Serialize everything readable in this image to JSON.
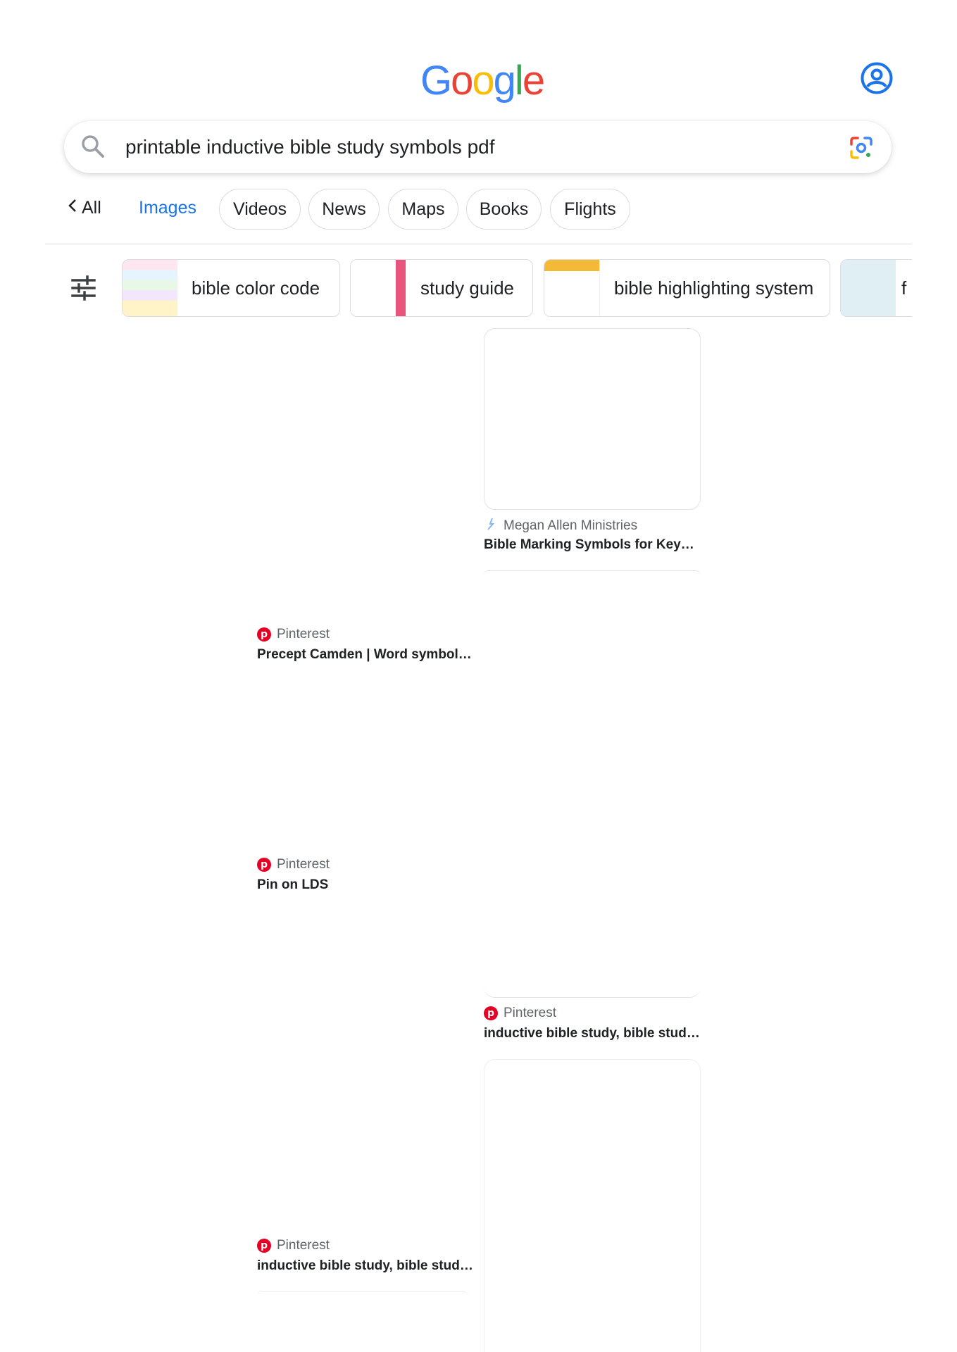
{
  "logo": {
    "letters": [
      "G",
      "o",
      "o",
      "g",
      "l",
      "e"
    ],
    "colors": [
      "#4285F4",
      "#EA4335",
      "#FBBC05",
      "#4285F4",
      "#34A853",
      "#EA4335"
    ]
  },
  "search": {
    "query": "printable inductive bible study symbols pdf"
  },
  "tabs": {
    "back_label": "All",
    "active": "Images",
    "chips": [
      "Videos",
      "News",
      "Maps",
      "Books",
      "Flights"
    ]
  },
  "refinements": [
    {
      "label": "bible color code"
    },
    {
      "label": "study guide"
    },
    {
      "label": "bible highlighting system"
    },
    {
      "label": "f"
    }
  ],
  "results": [
    {
      "source": "Megan Allen Ministries",
      "title": "Bible Marking Symbols for Key…",
      "icon": "sparkle-icon"
    },
    {
      "source": "Pinterest",
      "title": "Precept Camden | Word symbol…",
      "icon": "pinterest-icon"
    },
    {
      "source": "Pinterest",
      "title": "Pin on LDS",
      "icon": "pinterest-icon"
    },
    {
      "source": "Pinterest",
      "title": "inductive bible study, bible stud…",
      "icon": "pinterest-icon"
    },
    {
      "source": "Pinterest",
      "title": "inductive bible study, bible stud…",
      "icon": "pinterest-icon"
    }
  ],
  "colors": {
    "accent": "#1a73e8",
    "pinterest": "#e60023"
  }
}
